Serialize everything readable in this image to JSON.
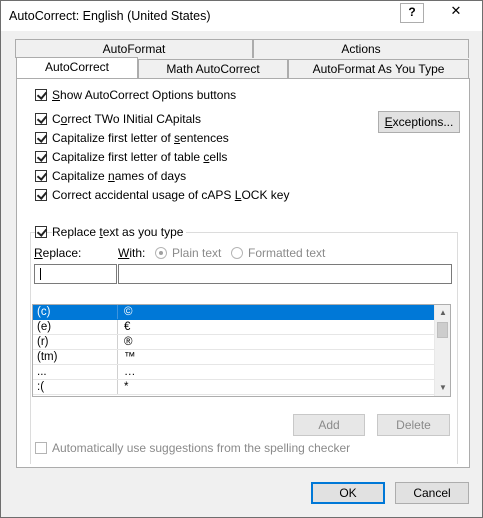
{
  "window": {
    "title": "AutoCorrect: English (United States)",
    "help_label": "?",
    "close_label": "✕"
  },
  "tabs": {
    "back_row": [
      "AutoFormat",
      "Actions"
    ],
    "front_row": [
      "AutoCorrect",
      "Math AutoCorrect",
      "AutoFormat As You Type"
    ],
    "active": "AutoCorrect"
  },
  "options": {
    "show_buttons": {
      "pre": "",
      "key": "S",
      "post": "how AutoCorrect Options buttons",
      "checked": true
    },
    "two_initial": {
      "pre": "C",
      "key": "o",
      "post": "rrect TWo INitial CApitals",
      "checked": true
    },
    "cap_sentences": {
      "pre": "Capitalize first letter of ",
      "key": "s",
      "post": "entences",
      "checked": true
    },
    "cap_table": {
      "pre": "Capitalize first letter of table ",
      "key": "c",
      "post": "ells",
      "checked": true
    },
    "cap_days": {
      "pre": "Capitalize ",
      "key": "n",
      "post": "ames of days",
      "checked": true
    },
    "caps_lock": {
      "pre": "Correct accidental usage of cAPS ",
      "key": "L",
      "post": "OCK key",
      "checked": true
    }
  },
  "exceptions_button": {
    "pre": "",
    "key": "E",
    "post": "xceptions..."
  },
  "replace_section": {
    "checkbox": {
      "pre": "Replace ",
      "key": "t",
      "post": "ext as you type",
      "checked": true
    },
    "replace_label_key": "R",
    "replace_label_rest": "eplace:",
    "with_label_key": "W",
    "with_label_rest": "ith:",
    "plain_text": "Plain text",
    "formatted_text": "Formatted text",
    "replace_value": "",
    "with_value": ""
  },
  "entries": [
    {
      "replace": "(c)",
      "with": "©"
    },
    {
      "replace": "(e)",
      "with": "€"
    },
    {
      "replace": "(r)",
      "with": "®"
    },
    {
      "replace": "(tm)",
      "with": "™"
    },
    {
      "replace": "...",
      "with": "…"
    },
    {
      "replace": ":(",
      "with": "*"
    }
  ],
  "action_buttons": {
    "add": "Add",
    "delete": "Delete"
  },
  "spelling_suggestions": "Automatically use suggestions from the spelling checker",
  "footer": {
    "ok": "OK",
    "cancel": "Cancel"
  }
}
